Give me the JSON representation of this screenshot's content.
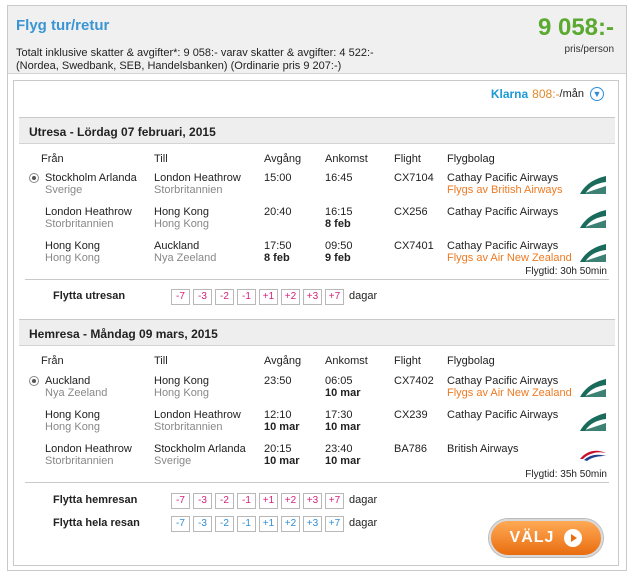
{
  "header": {
    "title": "Flyg tur/retur",
    "price": "9 058:-",
    "price_sub": "pris/person",
    "total_line1": "Totalt inklusive skatter & avgifter*: 9 058:- varav skatter & avgifter: 4 522:-",
    "total_line2": "(Nordea, Swedbank, SEB, Handelsbanken) (Ordinarie pris 9 207:-)"
  },
  "klarna": {
    "logo": "Klarna",
    "amount": "808:-",
    "suffix": "/mån",
    "icon": "chevron-down-icon"
  },
  "columns": {
    "from": "Från",
    "to": "Till",
    "dep": "Avgång",
    "arr": "Ankomst",
    "flight": "Flight",
    "airline": "Flygbolag"
  },
  "outbound": {
    "title": "Utresa - Lördag 07 februari, 2015",
    "legs": [
      {
        "from": "Stockholm Arlanda",
        "from_country": "Sverige",
        "to": "London Heathrow",
        "to_country": "Storbritannien",
        "dep": "15:00",
        "dep_date": "",
        "arr": "16:45",
        "arr_date": "",
        "flight": "CX7104",
        "airline": "Cathay Pacific Airways",
        "operated": "Flygs av British Airways",
        "logo": "cathay-pacific-logo"
      },
      {
        "from": "London Heathrow",
        "from_country": "Storbritannien",
        "to": "Hong Kong",
        "to_country": "Hong Kong",
        "dep": "20:40",
        "dep_date": "",
        "arr": "16:15",
        "arr_date": "8 feb",
        "flight": "CX256",
        "airline": "Cathay Pacific Airways",
        "operated": "",
        "logo": "cathay-pacific-logo"
      },
      {
        "from": "Hong Kong",
        "from_country": "Hong Kong",
        "to": "Auckland",
        "to_country": "Nya Zeeland",
        "dep": "17:50",
        "dep_date": "8 feb",
        "arr": "09:50",
        "arr_date": "9 feb",
        "flight": "CX7401",
        "airline": "Cathay Pacific Airways",
        "operated": "Flygs av Air New Zealand",
        "logo": "cathay-pacific-logo"
      }
    ],
    "flygtid": "Flygtid: 30h 50min",
    "move_label": "Flytta utresan",
    "days": [
      "-7",
      "-3",
      "-2",
      "-1",
      "+1",
      "+2",
      "+3",
      "+7"
    ],
    "dagar": "dagar"
  },
  "inbound": {
    "title": "Hemresa - Måndag 09 mars, 2015",
    "legs": [
      {
        "from": "Auckland",
        "from_country": "Nya Zeeland",
        "to": "Hong Kong",
        "to_country": "Hong Kong",
        "dep": "23:50",
        "dep_date": "",
        "arr": "06:05",
        "arr_date": "10 mar",
        "flight": "CX7402",
        "airline": "Cathay Pacific Airways",
        "operated": "Flygs av Air New Zealand",
        "logo": "cathay-pacific-logo"
      },
      {
        "from": "Hong Kong",
        "from_country": "Hong Kong",
        "to": "London Heathrow",
        "to_country": "Storbritannien",
        "dep": "12:10",
        "dep_date": "10 mar",
        "arr": "17:30",
        "arr_date": "10 mar",
        "flight": "CX239",
        "airline": "Cathay Pacific Airways",
        "operated": "",
        "logo": "cathay-pacific-logo"
      },
      {
        "from": "London Heathrow",
        "from_country": "Storbritannien",
        "to": "Stockholm Arlanda",
        "to_country": "Sverige",
        "dep": "20:15",
        "dep_date": "10 mar",
        "arr": "23:40",
        "arr_date": "10 mar",
        "flight": "BA786",
        "airline": "British Airways",
        "operated": "",
        "logo": "british-airways-logo"
      }
    ],
    "flygtid": "Flygtid: 35h 50min",
    "move_label": "Flytta hemresan",
    "move_all_label": "Flytta hela resan",
    "days": [
      "-7",
      "-3",
      "-2",
      "-1",
      "+1",
      "+2",
      "+3",
      "+7"
    ],
    "dagar": "dagar"
  },
  "select_button": "VÄLJ",
  "colors": {
    "title_blue": "#3a95d4",
    "price_green": "#5aa930",
    "operated_orange": "#ee7a23",
    "button_orange": "#e96d10",
    "day_pink": "#d4237a",
    "day_blue": "#2f8ed6"
  }
}
